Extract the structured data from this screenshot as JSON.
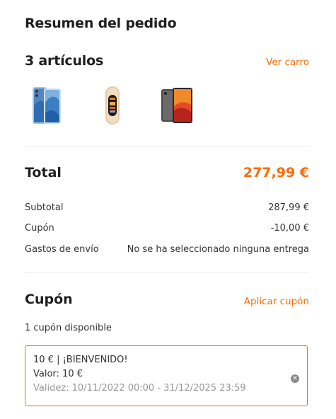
{
  "summary": {
    "title": "Resumen del pedido",
    "items_count_label": "3 artículos",
    "view_cart_label": "Ver carro",
    "products": [
      {
        "icon": "smartphone-product-image"
      },
      {
        "icon": "smart-band-product-image"
      },
      {
        "icon": "tablet-product-image"
      }
    ]
  },
  "totals": {
    "total_label": "Total",
    "total_value": "277,99 €",
    "rows": [
      {
        "label": "Subtotal",
        "value": "287,99 €"
      },
      {
        "label": "Cupón",
        "value": "-10,00 €"
      },
      {
        "label": "Gastos de envío",
        "value": "No se ha seleccionado ninguna entrega"
      }
    ]
  },
  "coupon": {
    "title": "Cupón",
    "apply_label": "Aplicar cupón",
    "available_text": "1 cupón disponible",
    "card": {
      "name": "10 € | ¡BIENVENIDO!",
      "value": "Valor: 10 €",
      "validity": "Validez: 10/11/2022 00:00 - 31/12/2025 23:59",
      "remove_icon": "close-circle-icon"
    }
  },
  "colors": {
    "accent": "#ff6a00",
    "text": "#1f1f1f",
    "muted": "#999999",
    "divider": "#ececec"
  }
}
